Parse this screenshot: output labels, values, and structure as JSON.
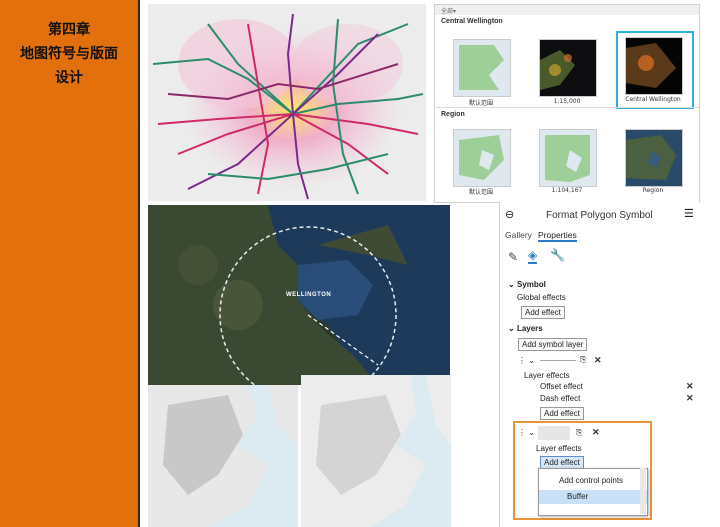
{
  "sidebar": {
    "chapter_lines": [
      "第四章",
      "地图符号与版面",
      "设计"
    ]
  },
  "bookmarks": {
    "header": "全部▾",
    "group1": "Central Wellington",
    "group2": "Region",
    "row1": [
      "默认范围",
      "1:15,000",
      "Central Wellington"
    ],
    "row2": [
      "默认范围",
      "1:104,167",
      "Region"
    ]
  },
  "map_label": "WELLINGTON",
  "format_panel": {
    "title": "Format Polygon Symbol",
    "tabs": [
      "Gallery",
      "Properties"
    ],
    "symbol_section": "Symbol",
    "global_effects": "Global effects",
    "add_effect": "Add effect",
    "layers_section": "Layers",
    "add_symbol_layer": "Add symbol layer",
    "layer_effects": "Layer effects",
    "offset_effect": "Offset effect",
    "dash_effect": "Dash effect",
    "menu_items": [
      "Add control points",
      "Buffer"
    ]
  },
  "colors": {
    "sidebar": "#e2700d",
    "highlight_orange": "#e8953a",
    "selected_border": "#2fb0e0"
  }
}
